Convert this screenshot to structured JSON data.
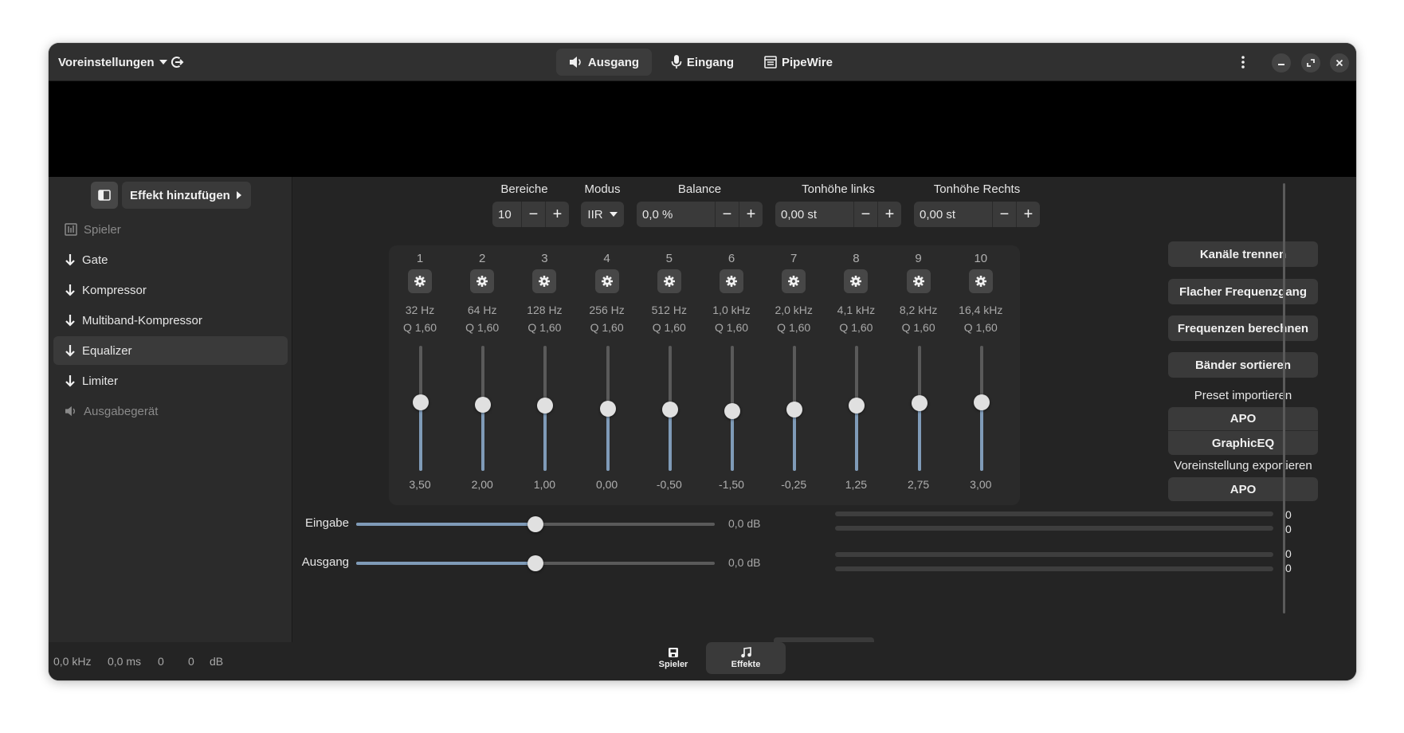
{
  "headerbar": {
    "presets_label": "Voreinstellungen",
    "tabs": [
      {
        "label": "Ausgang",
        "icon": "speaker-icon",
        "active": true
      },
      {
        "label": "Eingang",
        "icon": "microphone-icon",
        "active": false
      },
      {
        "label": "PipeWire",
        "icon": "pipewire-icon",
        "active": false
      }
    ]
  },
  "sidebar": {
    "add_effect_label": "Effekt hinzufügen",
    "items": [
      {
        "label": "Spieler",
        "icon": "player-icon",
        "dim": true
      },
      {
        "label": "Gate",
        "icon": "arrow-down-icon",
        "dim": false
      },
      {
        "label": "Kompressor",
        "icon": "arrow-down-icon",
        "dim": false
      },
      {
        "label": "Multiband-Kompressor",
        "icon": "arrow-down-icon",
        "dim": false
      },
      {
        "label": "Equalizer",
        "icon": "arrow-down-icon",
        "dim": false,
        "selected": true
      },
      {
        "label": "Limiter",
        "icon": "arrow-down-icon",
        "dim": false
      },
      {
        "label": "Ausgabegerät",
        "icon": "speaker-icon",
        "dim": true
      }
    ]
  },
  "controls": {
    "bereiche": {
      "label": "Bereiche",
      "value": "10"
    },
    "modus": {
      "label": "Modus",
      "value": "IIR"
    },
    "balance": {
      "label": "Balance",
      "value": "0,0 %"
    },
    "pitch_left": {
      "label": "Tonhöhe links",
      "value": "0,00 st"
    },
    "pitch_right": {
      "label": "Tonhöhe Rechts",
      "value": "0,00 st"
    }
  },
  "bands": [
    {
      "num": "1",
      "freq": "32 Hz",
      "q": "Q 1,60",
      "gain": "3,50",
      "level": 0.55
    },
    {
      "num": "2",
      "freq": "64 Hz",
      "q": "Q 1,60",
      "gain": "2,00",
      "level": 0.53
    },
    {
      "num": "3",
      "freq": "128 Hz",
      "q": "Q 1,60",
      "gain": "1,00",
      "level": 0.52
    },
    {
      "num": "4",
      "freq": "256 Hz",
      "q": "Q 1,60",
      "gain": "0,00",
      "level": 0.5
    },
    {
      "num": "5",
      "freq": "512 Hz",
      "q": "Q 1,60",
      "gain": "-0,50",
      "level": 0.49
    },
    {
      "num": "6",
      "freq": "1,0 kHz",
      "q": "Q 1,60",
      "gain": "-1,50",
      "level": 0.48
    },
    {
      "num": "7",
      "freq": "2,0 kHz",
      "q": "Q 1,60",
      "gain": "-0,25",
      "level": 0.49
    },
    {
      "num": "8",
      "freq": "4,1 kHz",
      "q": "Q 1,60",
      "gain": "1,25",
      "level": 0.52
    },
    {
      "num": "9",
      "freq": "8,2 kHz",
      "q": "Q 1,60",
      "gain": "2,75",
      "level": 0.54
    },
    {
      "num": "10",
      "freq": "16,4 kHz",
      "q": "Q 1,60",
      "gain": "3,00",
      "level": 0.55
    }
  ],
  "right_panel": {
    "split_channels": "Kanäle trennen",
    "flat_response": "Flacher Frequenzgang",
    "calc_freqs": "Frequenzen berechnen",
    "sort_bands": "Bänder sortieren",
    "import_label": "Preset importieren",
    "import_apo": "APO",
    "import_graphiceq": "GraphicEQ",
    "export_label": "Voreinstellung exportieren",
    "export_apo": "APO"
  },
  "gains": {
    "input": {
      "label": "Eingabe",
      "value": "0,0 dB",
      "level": 0.5
    },
    "output": {
      "label": "Ausgang",
      "value": "0,0 dB",
      "level": 0.5
    },
    "input_levels": [
      "0",
      "0"
    ],
    "output_levels": [
      "0",
      "0"
    ]
  },
  "statusbar": {
    "rate": "0,0 kHz",
    "latency": "0,0 ms",
    "v1": "0",
    "v2": "0",
    "unit": "dB"
  },
  "bottom_tabs": [
    {
      "label": "Spieler",
      "icon": "player-icon",
      "active": false
    },
    {
      "label": "Effekte",
      "icon": "music-note-icon",
      "active": true
    }
  ],
  "colors": {
    "accent": "#7f9bb8",
    "window_bg": "#242424",
    "headerbar_bg": "#303030"
  }
}
